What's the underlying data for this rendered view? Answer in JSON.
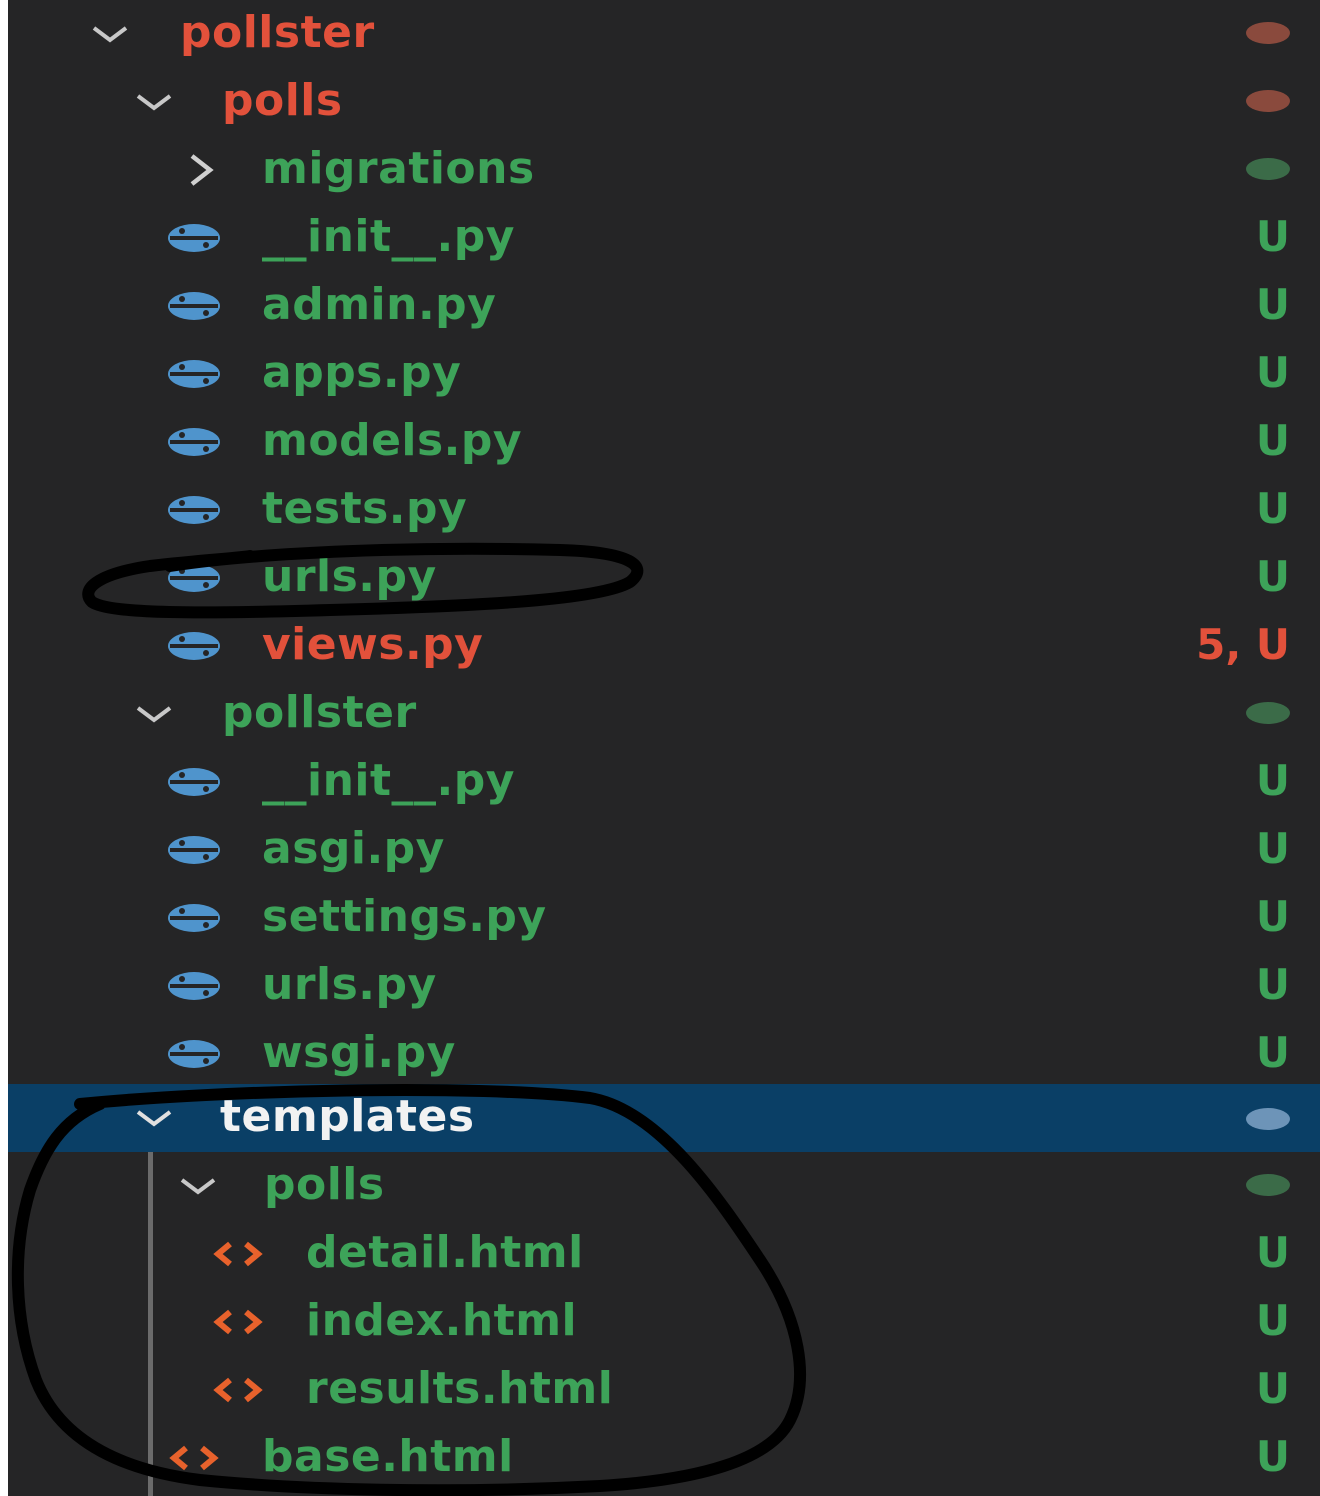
{
  "explorer": {
    "colors": {
      "background": "#252526",
      "selected_row": "#0a3f66",
      "error_red": "#e2513b",
      "untracked_green": "#3da359",
      "python_icon_blue": "#4f94cc",
      "html_icon_orange": "#e8622c"
    },
    "rows": [
      {
        "label": "pollster",
        "kind": "folder",
        "expanded": true,
        "status_dot": "red",
        "color": "red"
      },
      {
        "label": "polls",
        "kind": "folder",
        "expanded": true,
        "status_dot": "red",
        "color": "red"
      },
      {
        "label": "migrations",
        "kind": "folder",
        "expanded": false,
        "status_dot": "green",
        "color": "green"
      },
      {
        "label": "__init__.py",
        "kind": "python-file",
        "badge": "U",
        "color": "green"
      },
      {
        "label": "admin.py",
        "kind": "python-file",
        "badge": "U",
        "color": "green"
      },
      {
        "label": "apps.py",
        "kind": "python-file",
        "badge": "U",
        "color": "green"
      },
      {
        "label": "models.py",
        "kind": "python-file",
        "badge": "U",
        "color": "green"
      },
      {
        "label": "tests.py",
        "kind": "python-file",
        "badge": "U",
        "color": "green"
      },
      {
        "label": "urls.py",
        "kind": "python-file",
        "badge": "U",
        "color": "green"
      },
      {
        "label": "views.py",
        "kind": "python-file",
        "badge": "5, U",
        "color": "red"
      },
      {
        "label": "pollster",
        "kind": "folder",
        "expanded": true,
        "status_dot": "green",
        "color": "green"
      },
      {
        "label": "__init__.py",
        "kind": "python-file",
        "badge": "U",
        "color": "green"
      },
      {
        "label": "asgi.py",
        "kind": "python-file",
        "badge": "U",
        "color": "green"
      },
      {
        "label": "settings.py",
        "kind": "python-file",
        "badge": "U",
        "color": "green"
      },
      {
        "label": "urls.py",
        "kind": "python-file",
        "badge": "U",
        "color": "green"
      },
      {
        "label": "wsgi.py",
        "kind": "python-file",
        "badge": "U",
        "color": "green"
      },
      {
        "label": "templates",
        "kind": "folder",
        "expanded": true,
        "status_dot": "blue",
        "color": "white",
        "selected": true
      },
      {
        "label": "polls",
        "kind": "folder",
        "expanded": true,
        "status_dot": "green",
        "color": "green"
      },
      {
        "label": "detail.html",
        "kind": "html-file",
        "badge": "U",
        "color": "green"
      },
      {
        "label": "index.html",
        "kind": "html-file",
        "badge": "U",
        "color": "green"
      },
      {
        "label": "results.html",
        "kind": "html-file",
        "badge": "U",
        "color": "green"
      },
      {
        "label": "base.html",
        "kind": "html-file",
        "badge": "U",
        "color": "green"
      }
    ]
  }
}
